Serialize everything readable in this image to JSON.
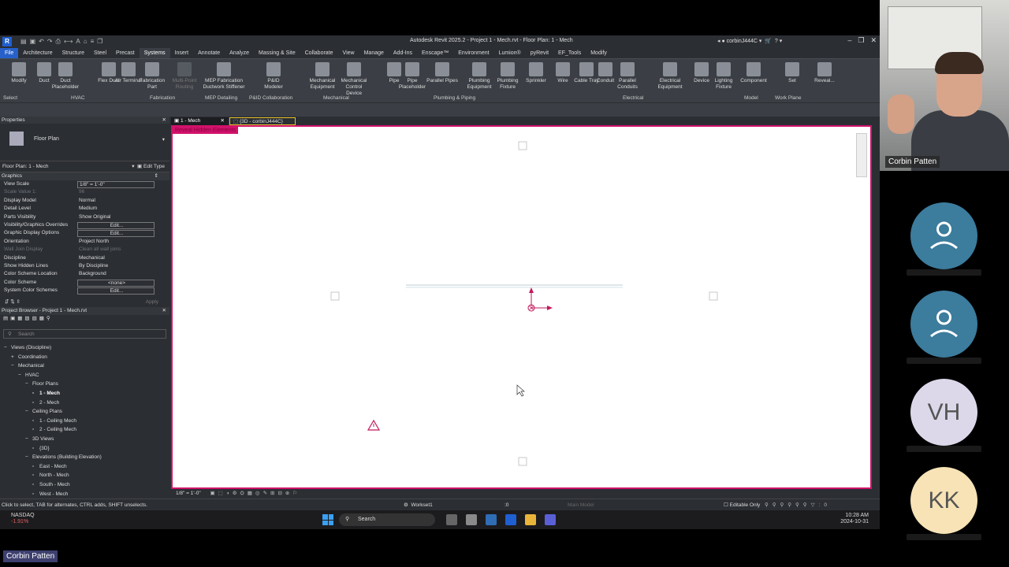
{
  "window": {
    "title": "Autodesk Revit 2025.2 - Project 1 - Mech.rvt - Floor Plan: 1 - Mech",
    "user": "corbinJ444C"
  },
  "menu": {
    "tabs": [
      "File",
      "Architecture",
      "Structure",
      "Steel",
      "Precast",
      "Systems",
      "Insert",
      "Annotate",
      "Analyze",
      "Massing & Site",
      "Collaborate",
      "View",
      "Manage",
      "Add-Ins",
      "Enscape™",
      "Environment",
      "Lumion®",
      "pyRevit",
      "EF_Tools",
      "Modify"
    ],
    "active": "Systems"
  },
  "ribbon": {
    "buttons": [
      "Modify",
      "Duct",
      "Duct Placeholder",
      "Flex Duct",
      "Air Terminal",
      "Fabrication Part",
      "Multi-Point Routing",
      "MEP Fabrication Ductwork Stiffener",
      "P&ID Modeler",
      "Mechanical Equipment",
      "Mechanical Control Device",
      "Pipe",
      "Pipe Placeholder",
      "Parallel Pipes",
      "Plumbing Equipment",
      "Plumbing Fixture",
      "Sprinkler",
      "Wire",
      "Cable Tray",
      "Conduit",
      "Parallel Conduits",
      "Electrical Equipment",
      "Device",
      "Lighting Fixture",
      "Component",
      "Set",
      "Reveal..."
    ],
    "panels": [
      "Select",
      "HVAC",
      "Fabrication",
      "MEP Detailing",
      "P&ID Collaboration",
      "Mechanical",
      "Plumbing & Piping",
      "Electrical",
      "Model",
      "Work Plane"
    ]
  },
  "properties": {
    "header": "Properties",
    "type_name": "Floor Plan",
    "selector": "Floor Plan: 1 - Mech",
    "edit_type": "Edit Type",
    "group": "Graphics",
    "rows": [
      {
        "k": "View Scale",
        "v": "1/8\" = 1'-0\""
      },
      {
        "k": "Scale Value 1:",
        "v": "96"
      },
      {
        "k": "Display Model",
        "v": "Normal"
      },
      {
        "k": "Detail Level",
        "v": "Medium"
      },
      {
        "k": "Parts Visibility",
        "v": "Show Original"
      },
      {
        "k": "Visibility/Graphics Overrides",
        "v": "Edit..."
      },
      {
        "k": "Graphic Display Options",
        "v": "Edit..."
      },
      {
        "k": "Orientation",
        "v": "Project North"
      },
      {
        "k": "Wall Join Display",
        "v": "Clean all wall joins"
      },
      {
        "k": "Discipline",
        "v": "Mechanical"
      },
      {
        "k": "Show Hidden Lines",
        "v": "By Discipline"
      },
      {
        "k": "Color Scheme Location",
        "v": "Background"
      },
      {
        "k": "Color Scheme",
        "v": "<none>"
      },
      {
        "k": "System Color Schemes",
        "v": "Edit..."
      }
    ],
    "apply": "Apply"
  },
  "browser": {
    "header": "Project Browser - Project 1 - Mech.rvt",
    "search_placeholder": "Search",
    "nodes": [
      {
        "label": "Views (Discipline)",
        "indent": 0,
        "bold": false,
        "pm": "−"
      },
      {
        "label": "Coordination",
        "indent": 1,
        "bold": false,
        "pm": "+"
      },
      {
        "label": "Mechanical",
        "indent": 1,
        "bold": false,
        "pm": "−"
      },
      {
        "label": "HVAC",
        "indent": 2,
        "bold": false,
        "pm": "−"
      },
      {
        "label": "Floor Plans",
        "indent": 3,
        "bold": false,
        "pm": "−"
      },
      {
        "label": "1 - Mech",
        "indent": 4,
        "bold": true,
        "pm": ""
      },
      {
        "label": "2 - Mech",
        "indent": 4,
        "bold": false,
        "pm": ""
      },
      {
        "label": "Ceiling Plans",
        "indent": 3,
        "bold": false,
        "pm": "−"
      },
      {
        "label": "1 - Ceiling Mech",
        "indent": 4,
        "bold": false,
        "pm": ""
      },
      {
        "label": "2 - Ceiling Mech",
        "indent": 4,
        "bold": false,
        "pm": ""
      },
      {
        "label": "3D Views",
        "indent": 3,
        "bold": false,
        "pm": "−"
      },
      {
        "label": "{3D}",
        "indent": 4,
        "bold": false,
        "pm": ""
      },
      {
        "label": "Elevations (Building Elevation)",
        "indent": 3,
        "bold": false,
        "pm": "−"
      },
      {
        "label": "East - Mech",
        "indent": 4,
        "bold": false,
        "pm": ""
      },
      {
        "label": "North - Mech",
        "indent": 4,
        "bold": false,
        "pm": ""
      },
      {
        "label": "South - Mech",
        "indent": 4,
        "bold": false,
        "pm": ""
      },
      {
        "label": "West - Mech",
        "indent": 4,
        "bold": false,
        "pm": ""
      }
    ]
  },
  "view_tabs": [
    "1 - Mech",
    "{3D - corbinJ444C}"
  ],
  "canvas": {
    "reveal_label": "Reveal Hidden Elements"
  },
  "view_control": {
    "scale": "1/8\" = 1'-0\""
  },
  "status": {
    "message": "Click to select, TAB for alternates, CTRL adds, SHIFT unselects.",
    "workset": "Workset1",
    "main_model": "Main Model",
    "editable_only": "Editable Only",
    "count": ":0"
  },
  "taskbar": {
    "ticker_name": "NASDAQ",
    "ticker_change": "-1.91%",
    "search": "Search",
    "time": "10:28 AM",
    "date": "2024-10-31"
  },
  "meeting": {
    "presenter": "Corbin Patten",
    "initials_3": "VH",
    "initials_4": "KK",
    "speaker_tag": "Corbin Patten"
  }
}
